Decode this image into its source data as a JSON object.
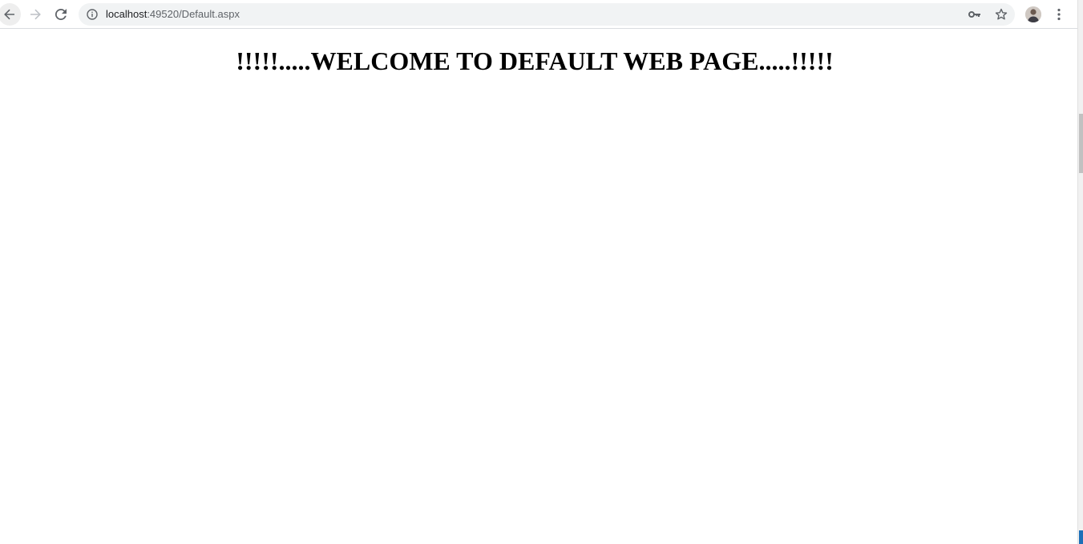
{
  "browser": {
    "nav": {
      "back_icon": "arrow-left-icon",
      "forward_icon": "arrow-right-icon",
      "reload_icon": "reload-icon",
      "menu_icon": "kebab-menu-icon"
    },
    "address_bar": {
      "host": "localhost",
      "path": ":49520/Default.aspx",
      "info_icon": "info-icon",
      "key_icon": "key-icon",
      "star_icon": "star-icon"
    },
    "profile_icon": "avatar-icon"
  },
  "page": {
    "heading": "!!!!!.....WELCOME TO DEFAULT WEB PAGE.....!!!!!"
  },
  "colors": {
    "toolbar_bg": "#ffffff",
    "omnibox_bg": "#f1f3f4",
    "icon": "#5f6368",
    "heading_text": "#000000",
    "corner_accent": "#1c6fb8"
  }
}
